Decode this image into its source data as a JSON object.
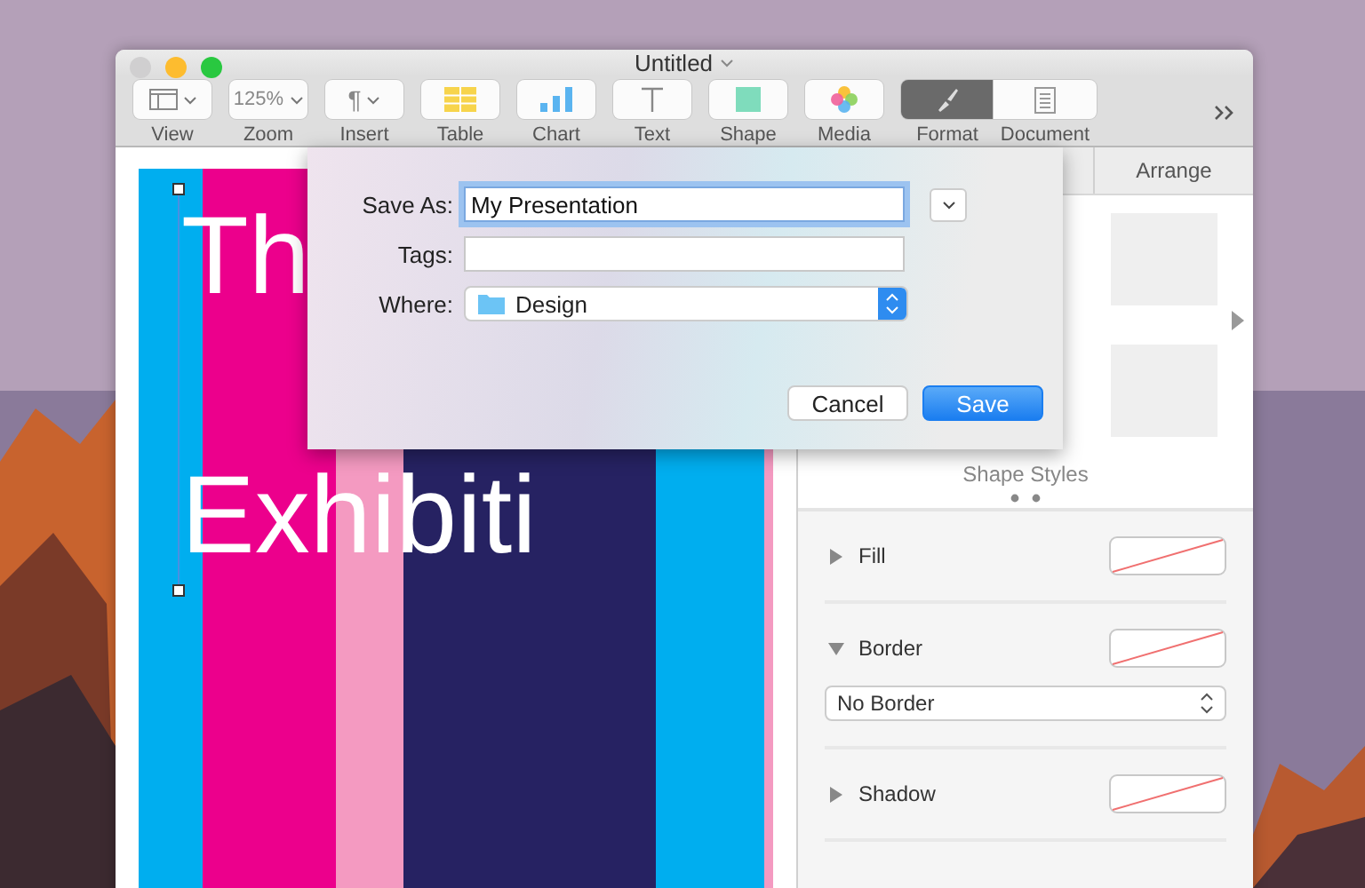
{
  "window": {
    "title": "Untitled"
  },
  "toolbar": {
    "items": [
      {
        "label": "View",
        "kind": "view",
        "selected": false
      },
      {
        "label": "Zoom",
        "kind": "zoom",
        "value": "125%",
        "selected": false
      },
      {
        "label": "Insert",
        "kind": "insert",
        "glyph": "¶",
        "selected": false
      },
      {
        "label": "Table",
        "kind": "table",
        "selected": false
      },
      {
        "label": "Chart",
        "kind": "chart",
        "selected": false
      },
      {
        "label": "Text",
        "kind": "text",
        "selected": false
      },
      {
        "label": "Shape",
        "kind": "shape",
        "selected": false
      },
      {
        "label": "Media",
        "kind": "media",
        "selected": false
      },
      {
        "label": "Format",
        "kind": "format",
        "selected": true
      },
      {
        "label": "Document",
        "kind": "document",
        "selected": false
      }
    ]
  },
  "slide": {
    "title_lines": [
      "Th",
      "Exhibiti"
    ],
    "stripes": [
      {
        "color": "#00aeef"
      },
      {
        "color": "#ec008c"
      },
      {
        "color": "#f49ac1"
      },
      {
        "color": "#262262"
      },
      {
        "color": "#00aeef"
      },
      {
        "color": "#f49ac1"
      }
    ]
  },
  "save_dialog": {
    "save_as": {
      "label": "Save As:",
      "value": "My Presentation"
    },
    "tags": {
      "label": "Tags:"
    },
    "where": {
      "label": "Where:",
      "value": "Design"
    },
    "buttons": [
      {
        "label": "Cancel",
        "default": false
      },
      {
        "label": "Save",
        "default": true
      }
    ]
  },
  "inspector": {
    "tabs": [
      {
        "label": "Arrange",
        "selected": false
      }
    ],
    "shape_styles": {
      "label": "Shape Styles"
    },
    "sections": [
      {
        "label": "Fill",
        "expanded": false
      },
      {
        "label": "Border",
        "expanded": true,
        "style": "No Border"
      },
      {
        "label": "Shadow",
        "expanded": false
      }
    ]
  }
}
